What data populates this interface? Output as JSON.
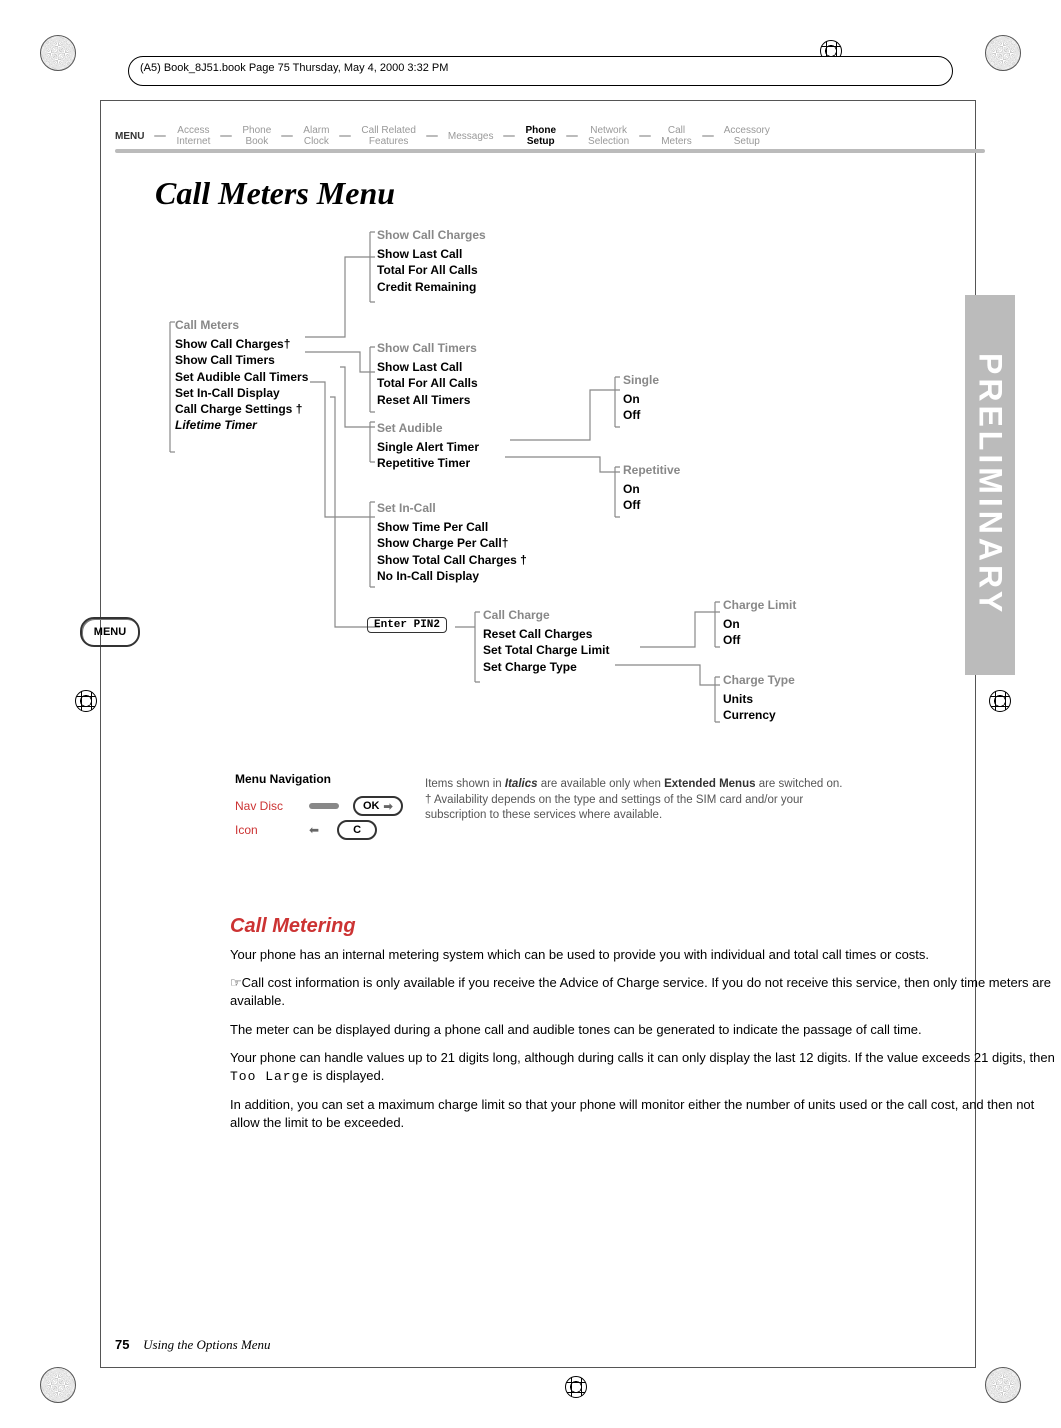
{
  "header": {
    "file_info": "(A5) Book_8J51.book  Page 75  Thursday, May 4, 2000  3:32 PM"
  },
  "nav": {
    "menu": "MENU",
    "items": [
      {
        "top": "Access",
        "bot": "Internet",
        "bold": false
      },
      {
        "top": "Phone",
        "bot": "Book",
        "bold": false
      },
      {
        "top": "Alarm",
        "bot": "Clock",
        "bold": false
      },
      {
        "top": "Call Related",
        "bot": "Features",
        "bold": false
      },
      {
        "top": "Messages",
        "bot": "",
        "bold": false
      },
      {
        "top": "Phone",
        "bot": "Setup",
        "bold": true
      },
      {
        "top": "Network",
        "bot": "Selection",
        "bold": false
      },
      {
        "top": "Call",
        "bot": "Meters",
        "bold": false
      },
      {
        "top": "Accessory",
        "bot": "Setup",
        "bold": false
      }
    ]
  },
  "title": "Call Meters Menu",
  "side_tab": "PRELIMINARY",
  "menu_button": "MENU",
  "groups": {
    "callMeters": {
      "head": "Call Meters",
      "items": [
        "Show Call Charges†",
        "Show Call Timers",
        "Set Audible Call Timers",
        "Set In-Call Display",
        "Call Charge Settings †"
      ],
      "last_italic": "Lifetime Timer"
    },
    "showCallCharges": {
      "head": "Show Call Charges",
      "items": [
        "Show Last Call",
        "Total For All Calls",
        "Credit Remaining"
      ]
    },
    "showCallTimers": {
      "head": "Show Call Timers",
      "items": [
        "Show Last Call",
        "Total For All Calls",
        "Reset All Timers"
      ]
    },
    "setAudible": {
      "head": "Set Audible",
      "items": [
        "Single Alert Timer",
        "Repetitive Timer"
      ]
    },
    "single": {
      "head": "Single",
      "items": [
        "On",
        "Off"
      ]
    },
    "repetitive": {
      "head": "Repetitive",
      "items": [
        "On",
        "Off"
      ]
    },
    "setInCall": {
      "head": "Set In-Call",
      "items": [
        "Show Time Per Call",
        "Show Charge Per Call†",
        "Show Total Call Charges †",
        "No In-Call Display"
      ]
    },
    "enterPin": "Enter PIN2",
    "callCharge": {
      "head": "Call Charge",
      "items": [
        "Reset Call Charges",
        "Set Total Charge Limit",
        "Set Charge Type"
      ]
    },
    "chargeLimit": {
      "head": "Charge Limit",
      "items": [
        "On",
        "Off"
      ]
    },
    "chargeType": {
      "head": "Charge Type",
      "items": [
        "Units",
        "Currency"
      ]
    }
  },
  "menuNav": {
    "header": "Menu Navigation",
    "navDisc": "Nav Disc",
    "icon": "Icon",
    "ok": "OK",
    "c": "C"
  },
  "notes": {
    "line1_pre": "Items shown in ",
    "line1_italics": "Italics",
    "line1_mid": " are available only when ",
    "line1_bold": "Extended Menus",
    "line1_post": " are switched on.",
    "line2": "† Availability depends on the type and settings of the SIM card and/or your subscription to these services where available."
  },
  "section": {
    "heading": "Call Metering",
    "p1": "Your phone has an internal metering system which can be used to provide you with individual and total call times or costs.",
    "p2": "☞Call cost information is only available if you receive the Advice of Charge service. If you do not receive this service, then only time meters are available.",
    "p3": "The meter can be displayed during a phone call and audible tones can be generated to indicate the passage of call time.",
    "p4_a": "Your phone can handle values up to 21 digits long, although during calls it can only display the last 12 digits. If the value exceeds 21 digits, then ",
    "p4_mono": "Too Large",
    "p4_b": " is displayed.",
    "p5": "In addition, you can set a maximum charge limit so that your phone will monitor either the number of units used or the call cost, and then not allow the limit to be exceeded."
  },
  "footer": {
    "page": "75",
    "caption": "Using the Options Menu"
  }
}
